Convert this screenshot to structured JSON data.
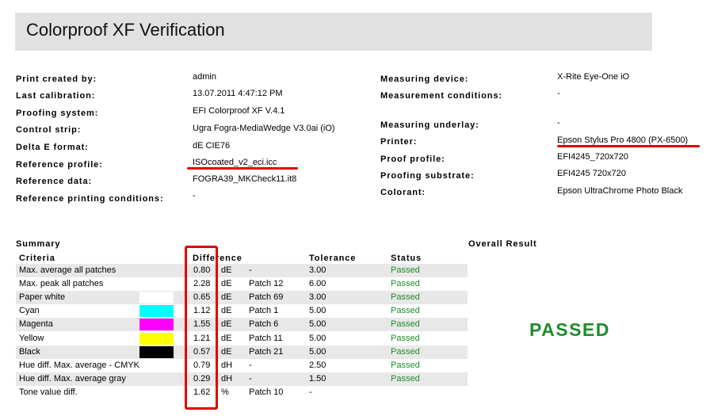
{
  "title": "Colorproof XF Verification",
  "info_left": [
    {
      "label": "Print created by:",
      "value": "admin"
    },
    {
      "label": "Last calibration:",
      "value": "13.07.2011 4:47:12 PM"
    },
    {
      "label": "Proofing system:",
      "value": "EFI Colorproof XF V.4.1"
    },
    {
      "label": "Control strip:",
      "value": "Ugra Fogra-MediaWedge V3.0ai (iO)"
    },
    {
      "label": "Delta E format:",
      "value": "dE CIE76"
    },
    {
      "label": "Reference profile:",
      "value": "ISOcoated_v2_eci.icc"
    },
    {
      "label": "Reference data:",
      "value": "FOGRA39_MKCheck11.it8"
    },
    {
      "label": "Reference printing conditions:",
      "value": "-"
    }
  ],
  "info_right": [
    {
      "label": "Measuring device:",
      "value": "X-Rite Eye-One iO"
    },
    {
      "label": "Measurement conditions:",
      "value": "-"
    },
    {
      "label": "Measuring underlay:",
      "value": "-"
    },
    {
      "label": "Printer:",
      "value": "Epson Stylus Pro 4800 (PX-6500)"
    },
    {
      "label": "Proof profile:",
      "value": "EFI4245_720x720"
    },
    {
      "label": "Proofing substrate:",
      "value": "EFI4245 720x720"
    },
    {
      "label": "Colorant:",
      "value": "Epson UltraChrome Photo Black"
    }
  ],
  "summary": {
    "title": "Summary",
    "overall_title": "Overall Result",
    "overall_value": "PASSED",
    "headers": {
      "criteria": "Criteria",
      "difference": "Difference",
      "tolerance": "Tolerance",
      "status": "Status"
    },
    "rows": [
      {
        "criteria": "Max. average all patches",
        "diff": "0.80",
        "unit": "dE",
        "patch": "-",
        "tolerance": "3.00",
        "status": "Passed",
        "swatch": ""
      },
      {
        "criteria": "Max. peak all patches",
        "diff": "2.28",
        "unit": "dE",
        "patch": "Patch 12",
        "tolerance": "6.00",
        "status": "Passed",
        "swatch": ""
      },
      {
        "criteria": "Paper white",
        "diff": "0.65",
        "unit": "dE",
        "patch": "Patch 69",
        "tolerance": "3.00",
        "status": "Passed",
        "swatch": "#ffffff"
      },
      {
        "criteria": "Cyan",
        "diff": "1.12",
        "unit": "dE",
        "patch": "Patch 1",
        "tolerance": "5.00",
        "status": "Passed",
        "swatch": "#00ffff"
      },
      {
        "criteria": "Magenta",
        "diff": "1.55",
        "unit": "dE",
        "patch": "Patch 6",
        "tolerance": "5.00",
        "status": "Passed",
        "swatch": "#ff00ff"
      },
      {
        "criteria": "Yellow",
        "diff": "1.21",
        "unit": "dE",
        "patch": "Patch 11",
        "tolerance": "5.00",
        "status": "Passed",
        "swatch": "#ffff00"
      },
      {
        "criteria": "Black",
        "diff": "0.57",
        "unit": "dE",
        "patch": "Patch 21",
        "tolerance": "5.00",
        "status": "Passed",
        "swatch": "#000000"
      },
      {
        "criteria": "Hue diff. Max. average - CMYK",
        "diff": "0.79",
        "unit": "dH",
        "patch": "-",
        "tolerance": "2.50",
        "status": "Passed",
        "swatch": ""
      },
      {
        "criteria": "Hue diff. Max. average gray",
        "diff": "0.29",
        "unit": "dH",
        "patch": "-",
        "tolerance": "1.50",
        "status": "Passed",
        "swatch": ""
      },
      {
        "criteria": "Tone value diff.",
        "diff": "1.62",
        "unit": "%",
        "patch": "Patch 10",
        "tolerance": "-",
        "status": "",
        "swatch": ""
      }
    ]
  },
  "colors": {
    "passed": "#1f8a2a",
    "highlight": "#e00000",
    "title_bg": "#e1e1e1",
    "row_bg": "#e8e8e8"
  }
}
